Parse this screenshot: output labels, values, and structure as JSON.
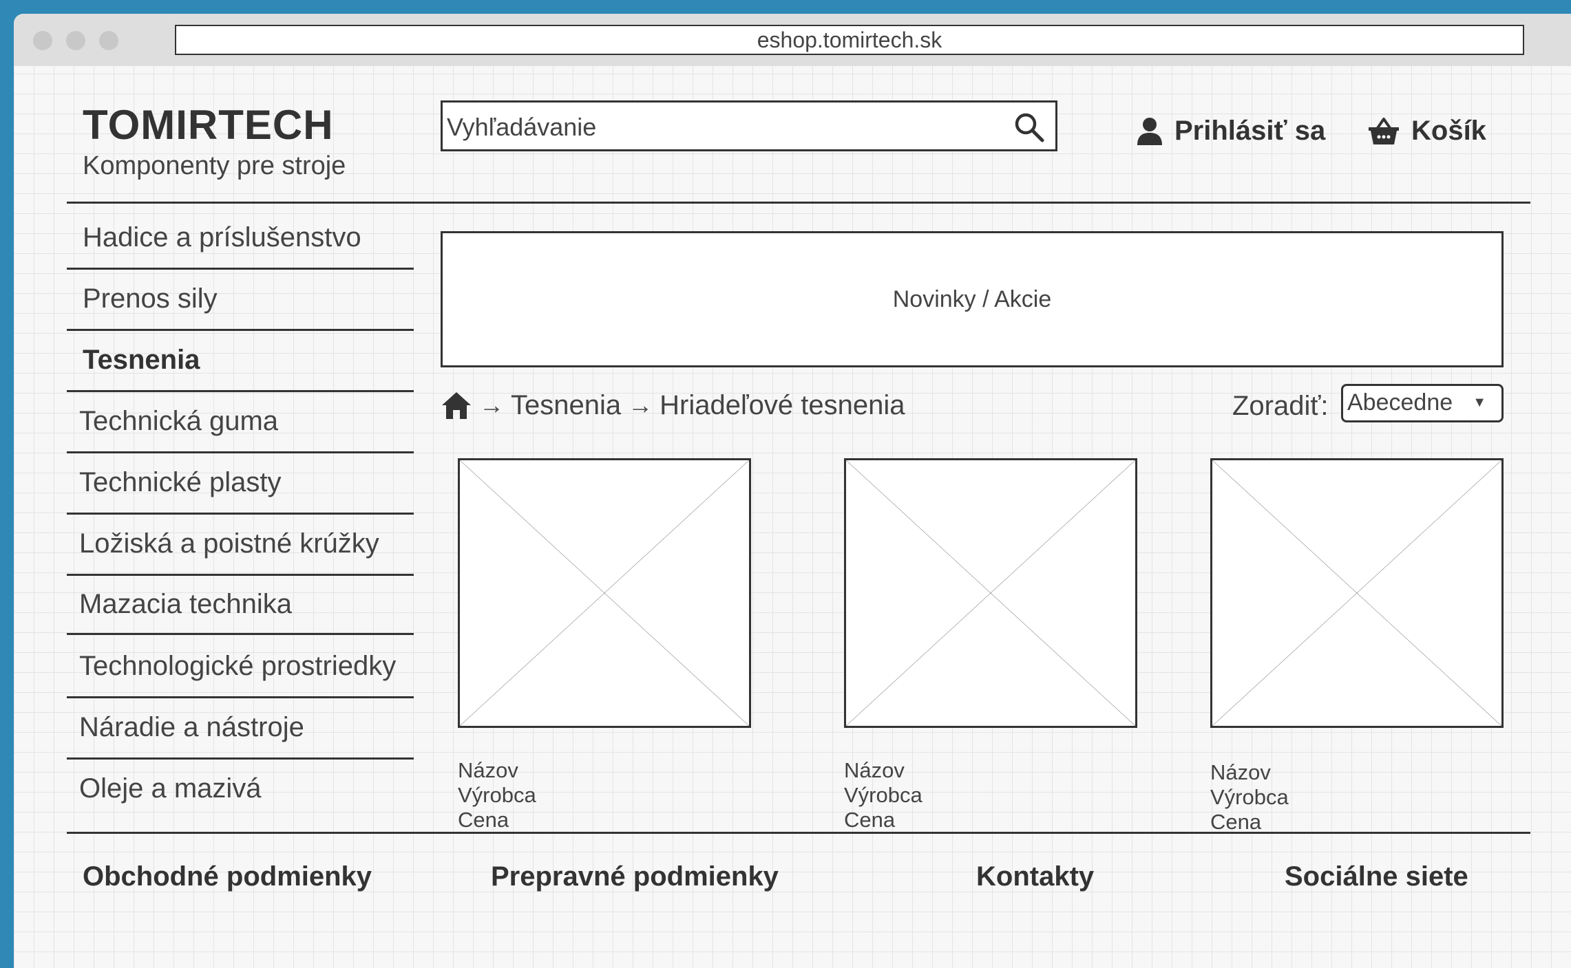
{
  "browser": {
    "url": "eshop.tomirtech.sk"
  },
  "header": {
    "logo": "TOMIRTECH",
    "tagline": "Komponenty pre stroje",
    "search_placeholder": "Vyhľadávanie",
    "login_label": "Prihlásiť sa",
    "cart_label": "Košík"
  },
  "sidebar": {
    "items": [
      {
        "label": "Hadice a príslušenstvo"
      },
      {
        "label": "Prenos sily"
      },
      {
        "label": "Tesnenia"
      },
      {
        "label": "Technická guma"
      },
      {
        "label": "Technické plasty"
      },
      {
        "label": "Ložiská a poistné krúžky"
      },
      {
        "label": "Mazacia technika"
      },
      {
        "label": "Technologické prostriedky"
      },
      {
        "label": "Náradie a nástroje"
      },
      {
        "label": "Oleje a mazivá"
      }
    ],
    "active": "Tesnenia"
  },
  "banner": {
    "label": "Novinky / Akcie"
  },
  "breadcrumb": {
    "items": [
      "Tesnenia",
      "Hriadeľové tesnenia"
    ],
    "separator": "→"
  },
  "sort": {
    "label": "Zoradiť:",
    "selected": "Abecedne"
  },
  "products": [
    {
      "name": "Názov",
      "maker": "Výrobca",
      "price": "Cena"
    },
    {
      "name": "Názov",
      "maker": "Výrobca",
      "price": "Cena"
    },
    {
      "name": "Názov",
      "maker": "Výrobca",
      "price": "Cena"
    }
  ],
  "footer": {
    "terms": "Obchodné podmienky",
    "shipping": "Prepravné podmienky",
    "contacts": "Kontakty",
    "social": "Sociálne siete"
  },
  "icons": {
    "home": "home-icon",
    "search": "search-icon",
    "user": "user-icon",
    "cart": "basket-icon"
  }
}
